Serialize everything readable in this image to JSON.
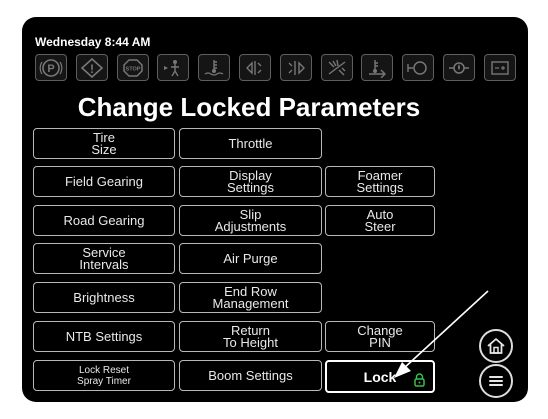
{
  "header": {
    "datetime": "Wednesday 8:44 AM"
  },
  "indicators": [
    {
      "name": "parking-brake-icon"
    },
    {
      "name": "warning-triangle-icon"
    },
    {
      "name": "stop-icon"
    },
    {
      "name": "operator-presence-icon"
    },
    {
      "name": "coolant-temperature-icon"
    },
    {
      "name": "left-turn-signal-icon"
    },
    {
      "name": "right-turn-signal-icon"
    },
    {
      "name": "spray-disabled-icon"
    },
    {
      "name": "hydraulic-oil-temperature-icon"
    },
    {
      "name": "engine-air-filter-icon"
    },
    {
      "name": "oil-pressure-icon"
    },
    {
      "name": "battery-icon"
    }
  ],
  "page": {
    "title": "Change Locked Parameters"
  },
  "buttons": {
    "tire_size": "Tire\nSize",
    "field_gearing": "Field Gearing",
    "road_gearing": "Road Gearing",
    "service_intervals": "Service\nIntervals",
    "brightness": "Brightness",
    "ntb_settings": "NTB Settings",
    "lock_reset_spray_timer": "Lock Reset\nSpray Timer",
    "throttle": "Throttle",
    "display_settings": "Display\nSettings",
    "slip_adjustments": "Slip\nAdjustments",
    "air_purge": "Air Purge",
    "end_row_management": "End Row\nManagement",
    "return_to_height": "Return\nTo Height",
    "boom_settings": "Boom Settings",
    "foamer_settings": "Foamer\nSettings",
    "auto_steer": "Auto\nSteer",
    "change_pin": "Change\nPIN",
    "lock": "Lock"
  },
  "colors": {
    "lock_indicator": "#39c04a",
    "screen_background": "#000000",
    "button_border": "#b8b8b8"
  }
}
